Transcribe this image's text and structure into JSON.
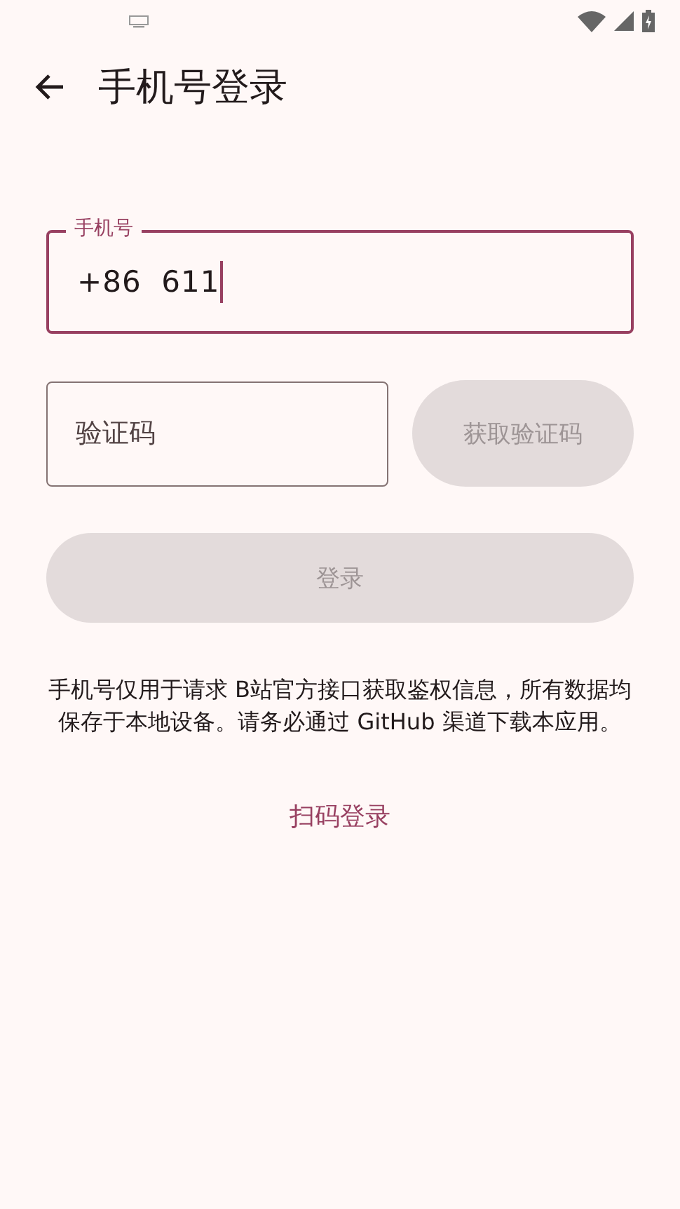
{
  "app_bar": {
    "title": "手机号登录"
  },
  "phone_field": {
    "label": "手机号",
    "value": "+86  611",
    "focused": true
  },
  "code_field": {
    "placeholder": "验证码",
    "focused": false
  },
  "get_code_button": {
    "label": "获取验证码",
    "disabled": true
  },
  "login_button": {
    "label": "登录",
    "disabled": true
  },
  "notice": "手机号仅用于请求 B站官方接口获取鉴权信息，所有数据均保存于本地设备。请务必通过 GitHub 渠道下载本应用。",
  "qr_login_link": "扫码登录"
}
